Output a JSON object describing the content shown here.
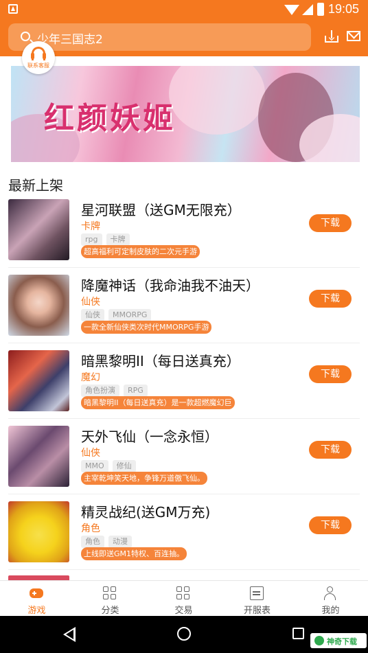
{
  "status_bar": {
    "time": "19:05"
  },
  "header": {
    "search_text": "少年三国志2",
    "download_icon": "download-icon",
    "mail_icon": "mail-icon"
  },
  "customer_service": {
    "label": "联系客服"
  },
  "banner": {
    "title": "红颜妖姬",
    "subtitle": ""
  },
  "section": {
    "title": "最新上架"
  },
  "games": [
    {
      "name": "星河联盟（送GM无限充）",
      "genre": "卡牌",
      "tags": [
        "rpg",
        "卡牌"
      ],
      "desc": "超高福利可定制皮肤的二次元手游",
      "button": "下载"
    },
    {
      "name": "降魔神话（我命油我不油天）",
      "genre": "仙侠",
      "tags": [
        "仙侠",
        "MMORPG"
      ],
      "desc": "一款全新仙侠类次时代MMORPG手游",
      "button": "下载"
    },
    {
      "name": "暗黑黎明II（每日送真充）",
      "genre": "魔幻",
      "tags": [
        "角色扮演",
        "RPG"
      ],
      "desc": "暗黑黎明II（每日送真充）是一款超燃魔幻巨",
      "button": "下载"
    },
    {
      "name": "天外飞仙（一念永恒）",
      "genre": "仙侠",
      "tags": [
        "MMO",
        "修仙"
      ],
      "desc": "主宰乾坤笑天地，争锋万道傲飞仙。",
      "button": "下载"
    },
    {
      "name": "精灵战纪(送GM万充)",
      "genre": "角色",
      "tags": [
        "角色",
        "动漫"
      ],
      "desc": "上线即送GM1特权、百连抽。",
      "button": "下载"
    }
  ],
  "bottom_nav": [
    {
      "label": "游戏",
      "icon": "gamepad-icon",
      "active": true
    },
    {
      "label": "分类",
      "icon": "grid-icon",
      "active": false
    },
    {
      "label": "交易",
      "icon": "grid-icon",
      "active": false
    },
    {
      "label": "开服表",
      "icon": "calendar-icon",
      "active": false
    },
    {
      "label": "我的",
      "icon": "person-icon",
      "active": false
    }
  ],
  "watermark": {
    "text": "神奇下载"
  },
  "colors": {
    "accent": "#f5781f"
  }
}
